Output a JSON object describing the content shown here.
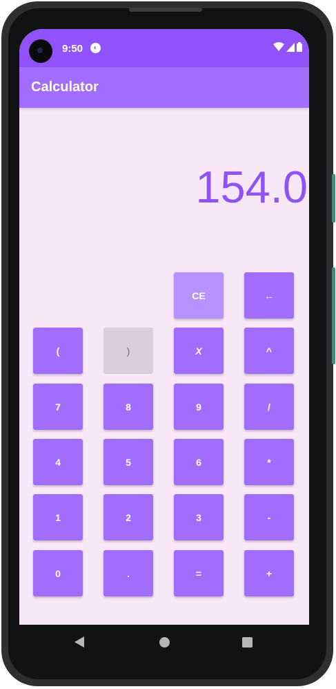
{
  "status_bar": {
    "time": "9:50",
    "icons": [
      "notification-app-icon",
      "wifi-icon",
      "signal-icon",
      "battery-icon"
    ]
  },
  "app_bar": {
    "title": "Calculator"
  },
  "display": {
    "value": "154.0"
  },
  "keypad": {
    "ce": "CE",
    "backspace": "←",
    "open_paren": "(",
    "close_paren": ")",
    "variable_x": "X",
    "power": "^",
    "seven": "7",
    "eight": "8",
    "nine": "9",
    "divide": "/",
    "four": "4",
    "five": "5",
    "six": "6",
    "multiply": "*",
    "one": "1",
    "two": "2",
    "three": "3",
    "minus": "-",
    "zero": "0",
    "decimal": ".",
    "equals": "=",
    "plus": "+"
  },
  "nav_bar": {
    "icons": [
      "back-icon",
      "home-icon",
      "recents-icon"
    ]
  },
  "colors": {
    "status_bar": "#9053fb",
    "app_bar": "#a26cfd",
    "background": "#f7e7f7",
    "button": "#a26cfd",
    "display_text": "#8f52f5",
    "disabled_button": "#dccbda"
  }
}
